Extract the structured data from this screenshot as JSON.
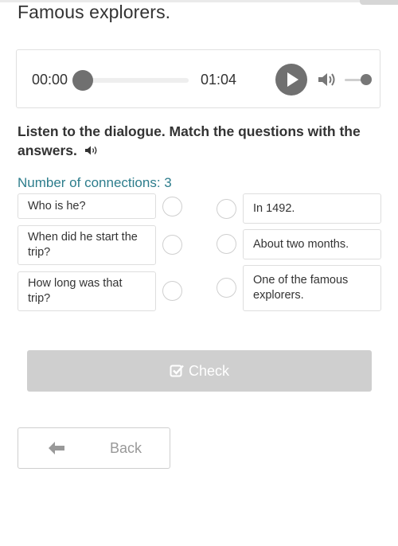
{
  "title": "Famous explorers.",
  "player": {
    "current_time": "00:00",
    "total_time": "01:04",
    "progress": 0,
    "volume": 1.0
  },
  "instruction": "Listen to the dialogue. Match the questions with the answers.",
  "connections_label": "Number of connections: 3",
  "questions": [
    {
      "text": "Who is he?"
    },
    {
      "text": "When did he start the trip?"
    },
    {
      "text": "How long was that trip?"
    }
  ],
  "answers": [
    {
      "text": "In 1492."
    },
    {
      "text": "About two months."
    },
    {
      "text": "One of the famous explorers."
    }
  ],
  "check_button": "Check",
  "back_button": "Back",
  "icons": {
    "play": "play-icon",
    "volume": "volume-icon",
    "speaker": "speaker-icon",
    "check": "checkbox-check-icon",
    "back": "arrow-left-icon"
  },
  "colors": {
    "accent_teal": "#2d7d8c",
    "button_disabled": "#cfcfcf",
    "player_gray": "#707070"
  }
}
